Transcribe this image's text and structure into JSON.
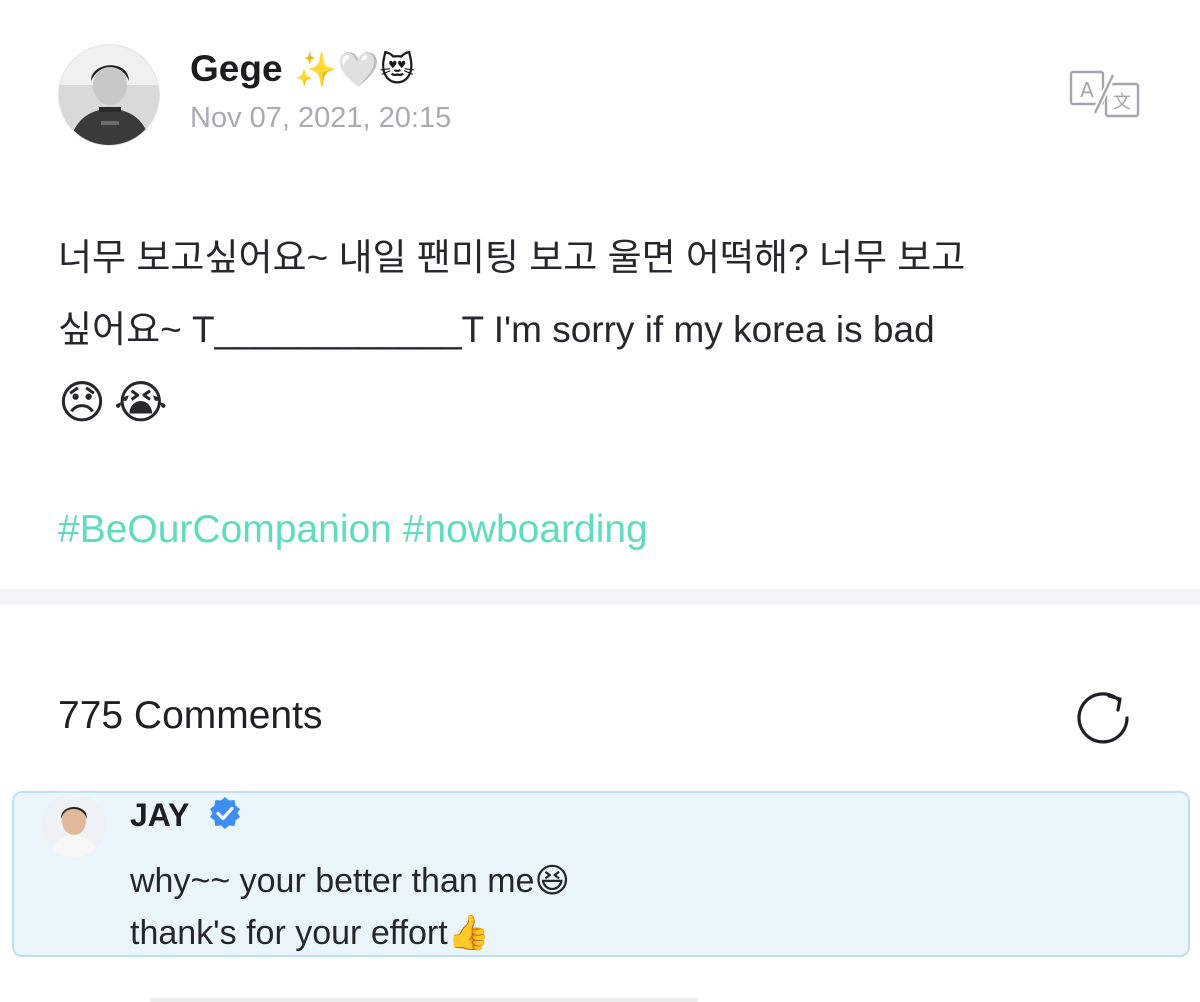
{
  "post": {
    "author": {
      "name": "Gege",
      "name_emojis": "✨🤍😻"
    },
    "date": "Nov 07, 2021, 20:15",
    "icons": {
      "translate": "translate-icon"
    },
    "body": {
      "line1": "너무 보고싶어요~ 내일 팬미팅 보고 울면 어떡해? 너무 보고",
      "line2": "싶어요~ T____________T I'm sorry if my korea is bad",
      "emoji_line": "😞😭"
    },
    "hashtags": [
      "#BeOurCompanion",
      "#nowboarding"
    ]
  },
  "comments": {
    "title": "775 Comments",
    "refresh_icon": "refresh-icon",
    "items": [
      {
        "author": "JAY",
        "verified": true,
        "line1": "why~~ your better than me",
        "line1_emoji": "😆",
        "line2": "thank's for your effort",
        "line2_emoji": "👍"
      }
    ]
  },
  "colors": {
    "hashtag": "#5ddcc1",
    "date": "#a9abb1",
    "comment_bg": "#ebf6fc",
    "comment_border": "#bfe0ef",
    "verified": "#3d8ef0",
    "divider": "#f4f5f8"
  }
}
